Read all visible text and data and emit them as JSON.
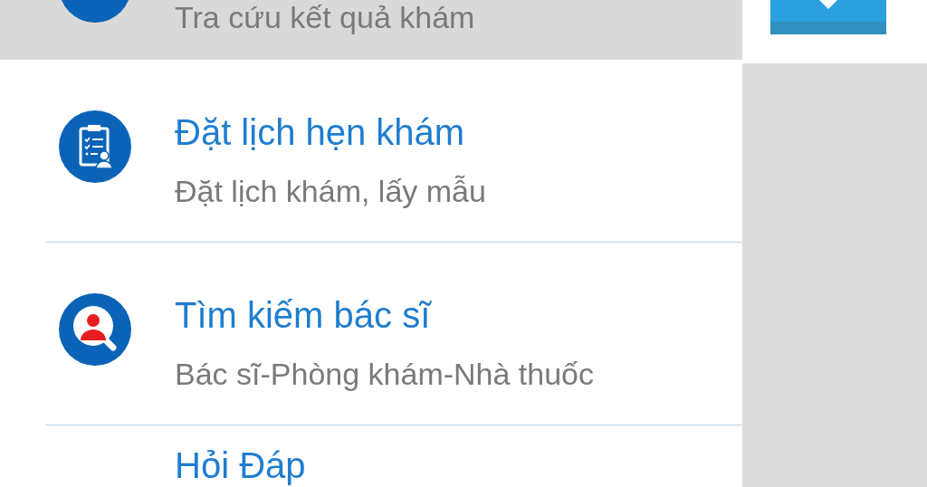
{
  "menu": {
    "items": [
      {
        "subtitle": "Tra cứu kết quả khám",
        "kind": "circle",
        "selected": true
      },
      {
        "title": "Đặt lịch hẹn khám",
        "subtitle": "Đặt lịch khám, lấy mẫu",
        "kind": "clipboard",
        "selected": false
      },
      {
        "title": "Tìm kiếm bác sĩ",
        "subtitle": "Bác sĩ-Phòng khám-Nhà thuốc",
        "kind": "doctor-search",
        "selected": false
      },
      {
        "title": "Hỏi Đáp",
        "selected": false
      }
    ]
  }
}
